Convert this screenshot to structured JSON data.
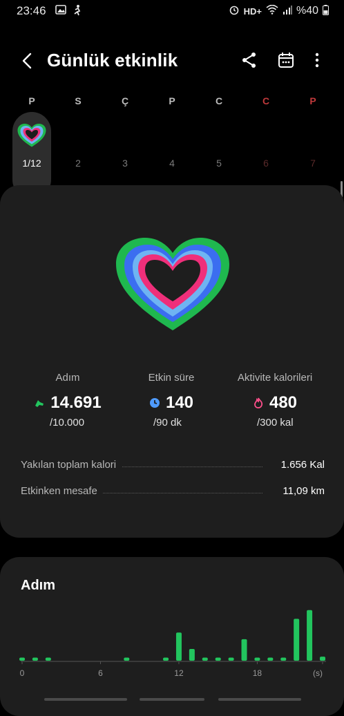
{
  "status_bar": {
    "time": "23:46",
    "network": "HD+",
    "battery": "%40",
    "icons": [
      "gallery-icon",
      "fitness-notification-icon",
      "alarm-icon",
      "wifi-icon",
      "signal-icon",
      "battery-icon"
    ]
  },
  "app_bar": {
    "title": "Günlük etkinlik",
    "actions": [
      "share-icon",
      "calendar-icon",
      "more-icon"
    ]
  },
  "week": {
    "days": [
      {
        "letter": "P",
        "num": "1/12",
        "selected": true,
        "weekend": false
      },
      {
        "letter": "S",
        "num": "2",
        "selected": false,
        "weekend": false
      },
      {
        "letter": "Ç",
        "num": "3",
        "selected": false,
        "weekend": false
      },
      {
        "letter": "P",
        "num": "4",
        "selected": false,
        "weekend": false
      },
      {
        "letter": "C",
        "num": "5",
        "selected": false,
        "weekend": false
      },
      {
        "letter": "C",
        "num": "6",
        "selected": false,
        "weekend": true
      },
      {
        "letter": "P",
        "num": "7",
        "selected": false,
        "weekend": true
      }
    ]
  },
  "summary": {
    "metrics": [
      {
        "label": "Adım",
        "value": "14.691",
        "goal": "/10.000",
        "icon": "steps-icon",
        "color": "#22c55e"
      },
      {
        "label": "Etkin süre",
        "value": "140",
        "goal": "/90 dk",
        "icon": "clock-icon",
        "color": "#4f9bff"
      },
      {
        "label": "Aktivite kalorileri",
        "value": "480",
        "goal": "/300 kal",
        "icon": "flame-icon",
        "color": "#ff4f8b"
      }
    ],
    "stats": [
      {
        "label": "Yakılan toplam kalori",
        "value": "1.656  Kal"
      },
      {
        "label": "Etkinken mesafe",
        "value": "11,09  km"
      }
    ]
  },
  "steps_card": {
    "title": "Adım"
  },
  "chart_data": {
    "type": "bar",
    "x_ticks": [
      "0",
      "6",
      "12",
      "18"
    ],
    "x_unit": "(s)",
    "categories": [
      "0",
      "1",
      "2",
      "3",
      "4",
      "5",
      "6",
      "7",
      "8",
      "9",
      "10",
      "11",
      "12",
      "13",
      "14",
      "15",
      "16",
      "17",
      "18",
      "19",
      "20",
      "21",
      "22",
      "23"
    ],
    "values": [
      0.06,
      0.06,
      0.06,
      0,
      0,
      0,
      0,
      0,
      0.06,
      0,
      0,
      0.06,
      0.55,
      0.23,
      0.06,
      0.06,
      0.06,
      0.42,
      0.06,
      0.06,
      0.06,
      0.82,
      0.99,
      0.08
    ],
    "value_scale": "relative height (no y-axis printed)",
    "bar_color": "#22c55e"
  },
  "colors": {
    "accent_green": "#22c55e",
    "accent_blue": "#4f9bff",
    "accent_pink": "#ff4f8b",
    "weekend_red": "#c0393b"
  }
}
